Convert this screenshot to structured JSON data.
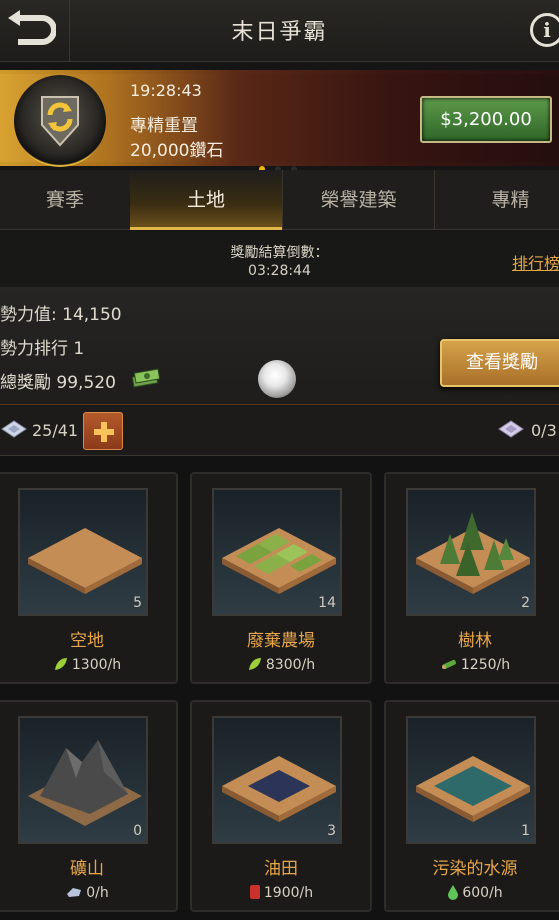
{
  "header": {
    "title": "末日爭霸",
    "info_glyph": "i",
    "back_icon": "back-arrow-icon"
  },
  "banner": {
    "time": "19:28:43",
    "name": "專精重置",
    "subtitle": "20,000鑽石",
    "price": "$3,200.00",
    "page_index": 1,
    "page_count": 3
  },
  "tabs": [
    {
      "label": "賽季",
      "active": false
    },
    {
      "label": "土地",
      "active": true
    },
    {
      "label": "榮譽建築",
      "active": false
    },
    {
      "label": "專精",
      "active": false
    }
  ],
  "countdown": {
    "label": "獎勵結算倒數：",
    "time": "03:28:44",
    "rank_link": "排行榜"
  },
  "stats": {
    "power": "勢力值: 14,150",
    "rank": "勢力排行  1",
    "total_reward": "總獎勵  99,520",
    "view_rewards": "查看獎勵"
  },
  "lands": {
    "count": "25/41",
    "count_right": "0/3"
  },
  "cards": [
    {
      "name": "空地",
      "count": "5",
      "rate": "1300/h",
      "resource_icon": "leaf-icon"
    },
    {
      "name": "廢棄農場",
      "count": "14",
      "rate": "8300/h",
      "resource_icon": "leaf-icon"
    },
    {
      "name": "樹林",
      "count": "2",
      "rate": "1250/h",
      "resource_icon": "wood-icon"
    },
    {
      "name": "礦山",
      "count": "0",
      "rate": "0/h",
      "resource_icon": "ore-icon"
    },
    {
      "name": "油田",
      "count": "3",
      "rate": "1900/h",
      "resource_icon": "oil-barrel-icon"
    },
    {
      "name": "污染的水源",
      "count": "1",
      "rate": "600/h",
      "resource_icon": "water-drop-icon"
    }
  ],
  "colors": {
    "accent": "#e2b648",
    "card_name": "#e7a64a",
    "price_button": "#3f7a34"
  }
}
